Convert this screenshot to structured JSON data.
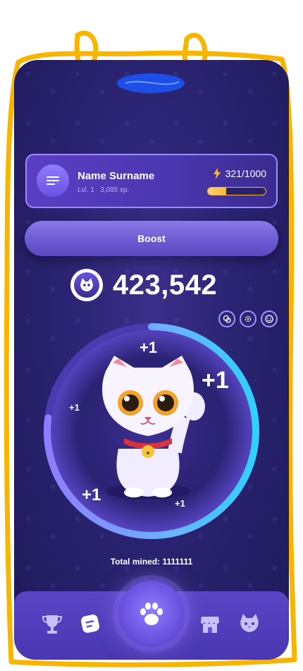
{
  "profile": {
    "name": "Name Surname",
    "level": "Lvl. 1",
    "xp": "3,095 xp.",
    "energy": "321/1000",
    "energy_fraction": 0.32
  },
  "boost_label": "Boost",
  "score": "423,542",
  "tap_popups": [
    "+1",
    "+1",
    "+1",
    "+1",
    "+1"
  ],
  "ring_progress_fraction": 0.77,
  "total_mined_label": "Total mined:",
  "total_mined_value": "1111111",
  "mini_icons": [
    "coins-icon",
    "settings-icon",
    "smile-icon"
  ],
  "nav": {
    "items": [
      "trophy-icon",
      "tasks-icon",
      "paw-icon",
      "shop-icon",
      "cat-icon"
    ]
  },
  "colors": {
    "accent": "#6a52e0",
    "gold": "#f5b83a",
    "background": "#2a2371"
  }
}
